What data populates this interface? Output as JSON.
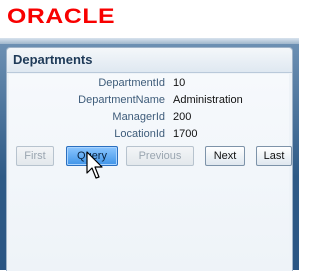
{
  "brand": {
    "logo_text": "ORACLE"
  },
  "panel": {
    "title": "Departments"
  },
  "form": {
    "fields": [
      {
        "label": "DepartmentId",
        "value": "10"
      },
      {
        "label": "DepartmentName",
        "value": "Administration"
      },
      {
        "label": "ManagerId",
        "value": "200"
      },
      {
        "label": "LocationId",
        "value": "1700"
      }
    ]
  },
  "buttons": {
    "first": "First",
    "query": "Query",
    "previous": "Previous",
    "next": "Next",
    "last": "Last"
  },
  "colors": {
    "brand_red": "#f80000",
    "frame_blue": "#2e5a86",
    "active_button": "#3f94e8"
  },
  "icons": {
    "cursor": "mouse-pointer-icon"
  }
}
